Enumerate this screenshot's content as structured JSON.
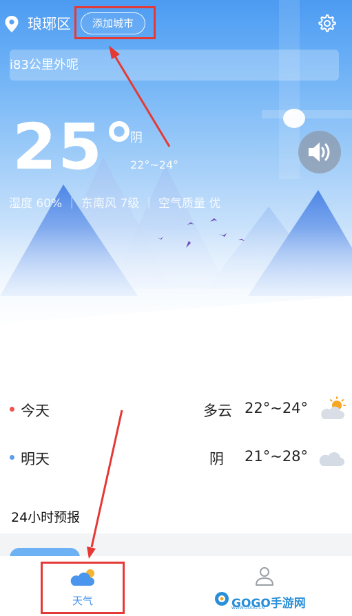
{
  "header": {
    "city": "琅琊区",
    "add_city_label": "添加城市"
  },
  "notice": {
    "text": "i83公里外呢"
  },
  "current": {
    "temperature": "25°",
    "condition": "阴",
    "range": "22°~24°",
    "details": "湿度 60%  ｜  东南风 7级  ｜  空气质量 优"
  },
  "forecast": [
    {
      "day": "今天",
      "condition": "多云",
      "range": "22°~24°",
      "icon": "partly-cloudy-icon",
      "dot_color": "#ef5350"
    },
    {
      "day": "明天",
      "condition": "阴",
      "range": "21°~28°",
      "icon": "cloudy-icon",
      "dot_color": "#5c9ded"
    }
  ],
  "hourly": {
    "title": "24小时预报"
  },
  "nav": {
    "weather_label": "天气"
  },
  "watermark": {
    "text": "GOGO手游网",
    "sub": "WWW.GOGO.CN"
  },
  "colors": {
    "accent": "#4a95ee",
    "annotation": "#e53935"
  }
}
